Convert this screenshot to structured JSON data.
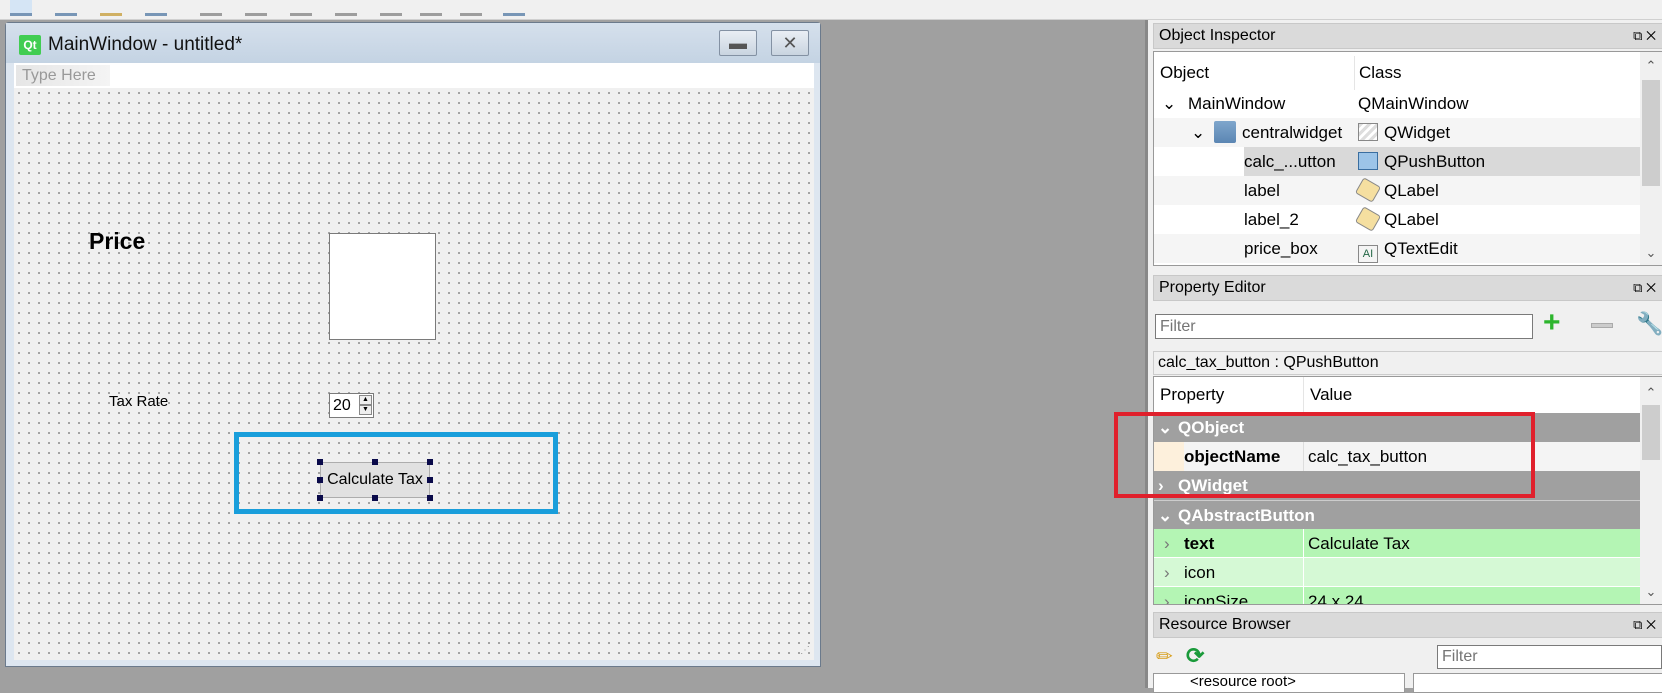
{
  "form": {
    "title": "MainWindow - untitled*",
    "qt_logo": "Qt",
    "minimize_icon": "minimize-icon",
    "close_icon": "close-icon",
    "menu_placeholder": "Type Here",
    "price_label": "Price",
    "tax_label": "Tax Rate",
    "tax_value": "20",
    "button_label": "Calculate Tax"
  },
  "object_inspector": {
    "title": "Object Inspector",
    "columns": [
      "Object",
      "Class"
    ],
    "rows": [
      {
        "object": "MainWindow",
        "class": "QMainWindow"
      },
      {
        "object": "centralwidget",
        "class": "QWidget"
      },
      {
        "object": "calc_...utton",
        "class": "QPushButton",
        "selected": true
      },
      {
        "object": "label",
        "class": "QLabel"
      },
      {
        "object": "label_2",
        "class": "QLabel"
      },
      {
        "object": "price_box",
        "class": "QTextEdit"
      }
    ]
  },
  "property_editor": {
    "title": "Property Editor",
    "filter_placeholder": "Filter",
    "selected": "calc_tax_button : QPushButton",
    "columns": [
      "Property",
      "Value"
    ],
    "rows": [
      {
        "property": "QObject",
        "value": "",
        "group": true
      },
      {
        "property": "objectName",
        "value": "calc_tax_button"
      },
      {
        "property": "QWidget",
        "value": "",
        "group": true
      },
      {
        "property": "QAbstractButton",
        "value": "",
        "group": true
      },
      {
        "property": "text",
        "value": "Calculate Tax"
      },
      {
        "property": "icon",
        "value": ""
      },
      {
        "property": "iconSize",
        "value": "24 x 24"
      }
    ]
  },
  "resource_browser": {
    "title": "Resource Browser",
    "filter_placeholder": "Filter",
    "root": "<resource root>"
  },
  "colors": {
    "highlight_blue": "#199edb",
    "highlight_red": "#e0202c",
    "group_gray": "#a0a0a0",
    "changed_green": "#b4f5b4"
  }
}
